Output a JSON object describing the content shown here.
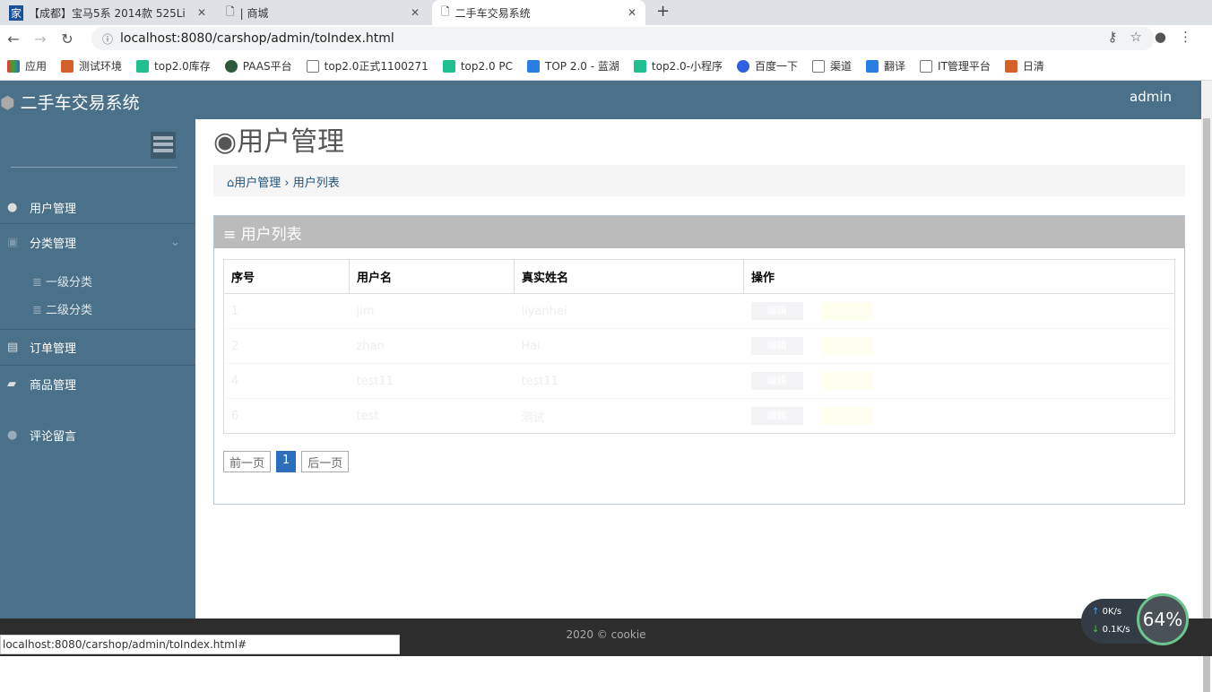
{
  "browser": {
    "tabs": [
      {
        "title": "【成都】宝马5系 2014款 525Li"
      },
      {
        "title": "| 商城"
      },
      {
        "title": "二手车交易系统"
      }
    ],
    "url": "localhost:8080/carshop/admin/toIndex.html",
    "bookmarks": [
      "应用",
      "测试环境",
      "top2.0库存",
      "PAAS平台",
      "top2.0正式1100271",
      "top2.0 PC",
      "TOP 2.0 - 蓝湖",
      "top2.0-小程序",
      "百度一下",
      "渠道",
      "翻译",
      "IT管理平台",
      "日清"
    ],
    "status_url": "localhost:8080/carshop/admin/toIndex.html#"
  },
  "app": {
    "title": "二手车交易系统",
    "user": "admin"
  },
  "sidebar": {
    "items": [
      {
        "label": "用户管理"
      },
      {
        "label": "分类管理"
      },
      {
        "label": "订单管理"
      },
      {
        "label": "商品管理"
      },
      {
        "label": "评论留言"
      }
    ],
    "sub": [
      "一级分类",
      "二级分类"
    ]
  },
  "page": {
    "title": "用户管理",
    "breadcrumb": [
      "用户管理",
      "用户列表"
    ],
    "panel_title": "用户列表"
  },
  "table": {
    "headers": [
      "序号",
      "用户名",
      "真实姓名",
      "操作"
    ],
    "rows": [
      {
        "id": "1",
        "user": "jim",
        "name": "liyanhei"
      },
      {
        "id": "2",
        "user": "zhan",
        "name": "Hai"
      },
      {
        "id": "4",
        "user": "test11",
        "name": "test11"
      },
      {
        "id": "6",
        "user": "test",
        "name": "测试"
      }
    ],
    "edit": "编辑",
    "del": "删除"
  },
  "pager": {
    "prev": "前一页",
    "current": "1",
    "next": "后一页"
  },
  "footer": "2020 © cookie",
  "net": {
    "up": "0K/s",
    "down": "0.1K/s",
    "cpu": "64%"
  }
}
